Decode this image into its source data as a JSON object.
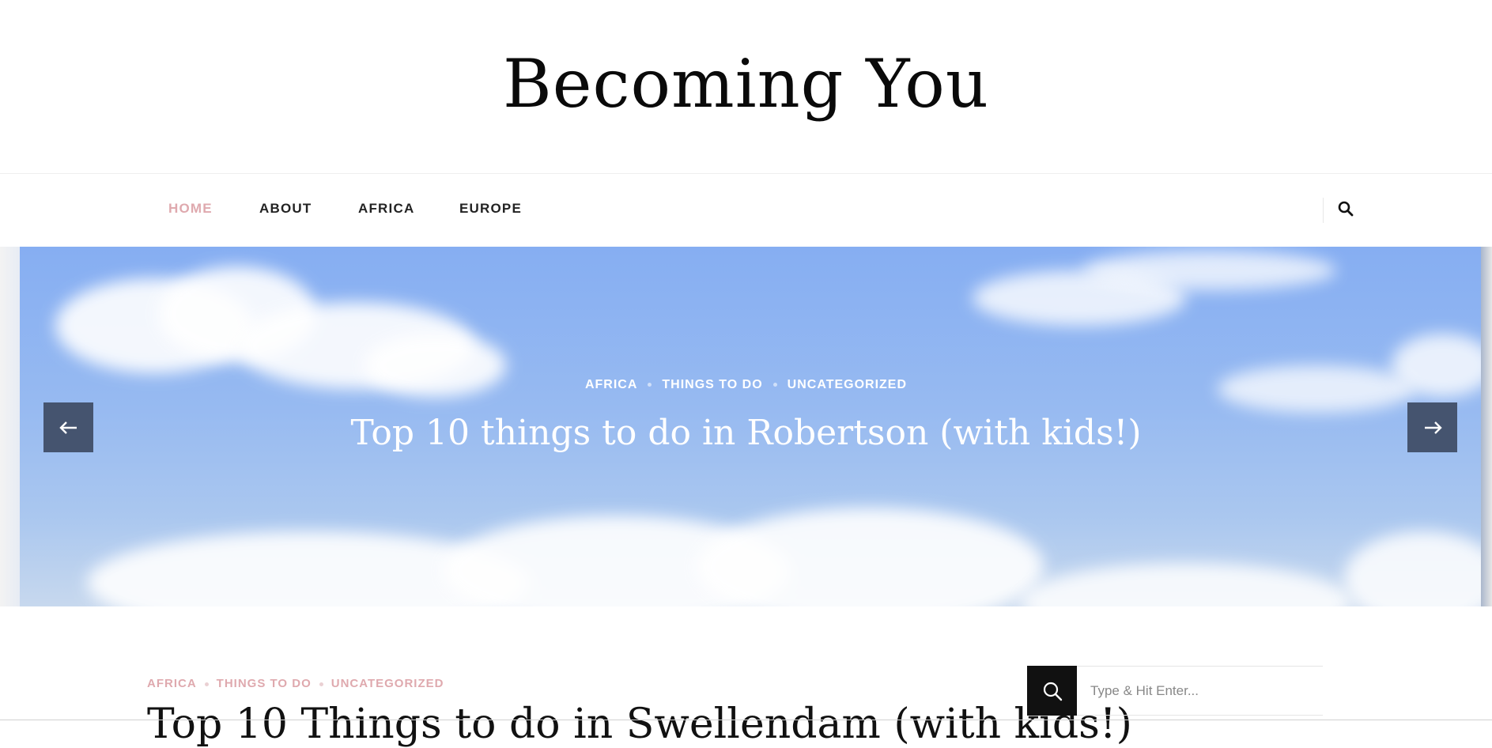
{
  "site": {
    "title": "Becoming You"
  },
  "nav": {
    "items": [
      {
        "label": "HOME",
        "active": true
      },
      {
        "label": "ABOUT"
      },
      {
        "label": "AFRICA"
      },
      {
        "label": "EUROPE"
      }
    ],
    "search_icon": "search-icon",
    "active_color": "#dfa9ae"
  },
  "hero": {
    "categories": [
      "AFRICA",
      "THINGS TO DO",
      "UNCATEGORIZED"
    ],
    "title": "Top 10 things to do in Robertson (with kids!)",
    "prev_icon": "arrow-left-icon",
    "next_icon": "arrow-right-icon",
    "button_color": "#45546f"
  },
  "post": {
    "categories": [
      "AFRICA",
      "THINGS TO DO",
      "UNCATEGORIZED"
    ],
    "title": "Top 10 Things to do in Swellendam (with kids!)"
  },
  "sidebar": {
    "search": {
      "placeholder": "Type & Hit Enter...",
      "icon": "search-icon"
    }
  }
}
